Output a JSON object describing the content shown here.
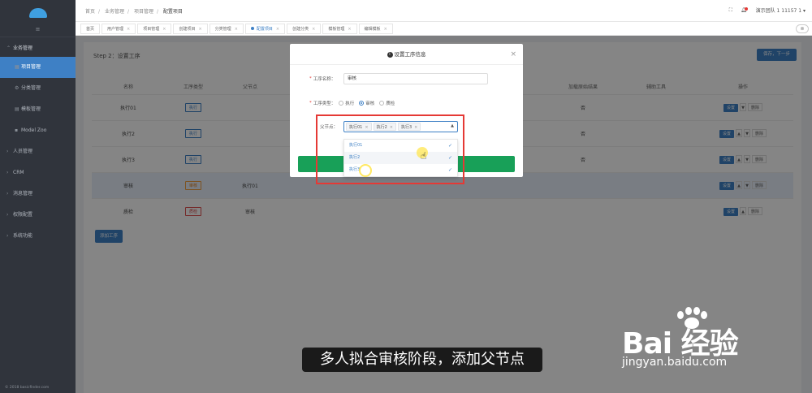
{
  "sidebar": {
    "collapse_icon": "≡",
    "groups": [
      {
        "label": "业务管理",
        "icon": "chevron-up"
      },
      {
        "label": "人员管理",
        "icon": "chevron-right"
      },
      {
        "label": "CRM",
        "icon": "chevron-right"
      },
      {
        "label": "消息管理",
        "icon": "chevron-right"
      },
      {
        "label": "权限配置",
        "icon": "chevron-right"
      },
      {
        "label": "系统功能",
        "icon": "chevron-right"
      }
    ],
    "sub_items": [
      {
        "label": "项目管理",
        "active": true
      },
      {
        "label": "分类管理",
        "active": false
      },
      {
        "label": "模板管理",
        "active": false
      },
      {
        "label": "Model Zoo",
        "active": false
      }
    ],
    "copyright": "© 2018 basicfinder.com"
  },
  "topbar": {
    "breadcrumb": [
      "首页",
      "业务管理",
      "项目管理",
      "配置项目"
    ],
    "user": "演示团队 1 11157 1",
    "accent": "#3e80c5"
  },
  "tabs": [
    {
      "label": "首页",
      "active": false,
      "closable": false
    },
    {
      "label": "用户管理",
      "active": false,
      "closable": true
    },
    {
      "label": "项目管理",
      "active": false,
      "closable": true
    },
    {
      "label": "创建项目",
      "active": false,
      "closable": true
    },
    {
      "label": "分类管理",
      "active": false,
      "closable": true
    },
    {
      "label": "配置项目",
      "active": true,
      "closable": true
    },
    {
      "label": "创建分类",
      "active": false,
      "closable": true
    },
    {
      "label": "模板管理",
      "active": false,
      "closable": true
    },
    {
      "label": "编辑模板",
      "active": false,
      "closable": true
    }
  ],
  "page": {
    "step_title": "Step 2：设置工序",
    "next_button": "保存，下一步",
    "add_button": "添加工序",
    "columns": [
      "名称",
      "工序类型",
      "父节点",
      "",
      "",
      "",
      "加载原始结果",
      "辅助工具",
      "操作"
    ],
    "rows": [
      {
        "name": "执行01",
        "type": "执行",
        "type_kind": "exec",
        "parent": "",
        "load": "否",
        "tool": "",
        "arrows": [
          "▼"
        ],
        "highlight": false
      },
      {
        "name": "执行2",
        "type": "执行",
        "type_kind": "exec",
        "parent": "",
        "load": "否",
        "tool": "",
        "arrows": [
          "▲",
          "▼"
        ],
        "highlight": false
      },
      {
        "name": "执行3",
        "type": "执行",
        "type_kind": "exec",
        "parent": "",
        "load": "否",
        "tool": "",
        "arrows": [
          "▲",
          "▼"
        ],
        "highlight": false
      },
      {
        "name": "审核",
        "type": "审核",
        "type_kind": "review",
        "parent": "执行01",
        "load": "",
        "tool": "",
        "arrows": [
          "▲",
          "▼"
        ],
        "highlight": true
      },
      {
        "name": "质检",
        "type": "质检",
        "type_kind": "qc",
        "parent": "审核",
        "load": "",
        "tool": "",
        "arrows": [
          "▲"
        ],
        "highlight": false
      }
    ],
    "op_set": "设置",
    "op_delete": "删除"
  },
  "modal": {
    "title": "设置工序信息",
    "name_label": "工序名称：",
    "name_value": "审核",
    "type_label": "工序类型：",
    "type_options": [
      {
        "label": "执行",
        "checked": false
      },
      {
        "label": "审核",
        "checked": true
      },
      {
        "label": "质检",
        "checked": false
      }
    ],
    "parent_label": "父节点：",
    "selected_parents": [
      "执行01",
      "执行2",
      "执行3"
    ],
    "dropdown_options": [
      {
        "label": "执行01",
        "checked": true,
        "hover": false
      },
      {
        "label": "执行2",
        "checked": true,
        "hover": true
      },
      {
        "label": "执行3",
        "checked": true,
        "hover": false
      }
    ],
    "confirm_color": "#18a058"
  },
  "subtitle": "多人拟合审核阶段，添加父节点",
  "watermark": {
    "logo": "Bai 经验",
    "url": "jingyan.baidu.com"
  }
}
